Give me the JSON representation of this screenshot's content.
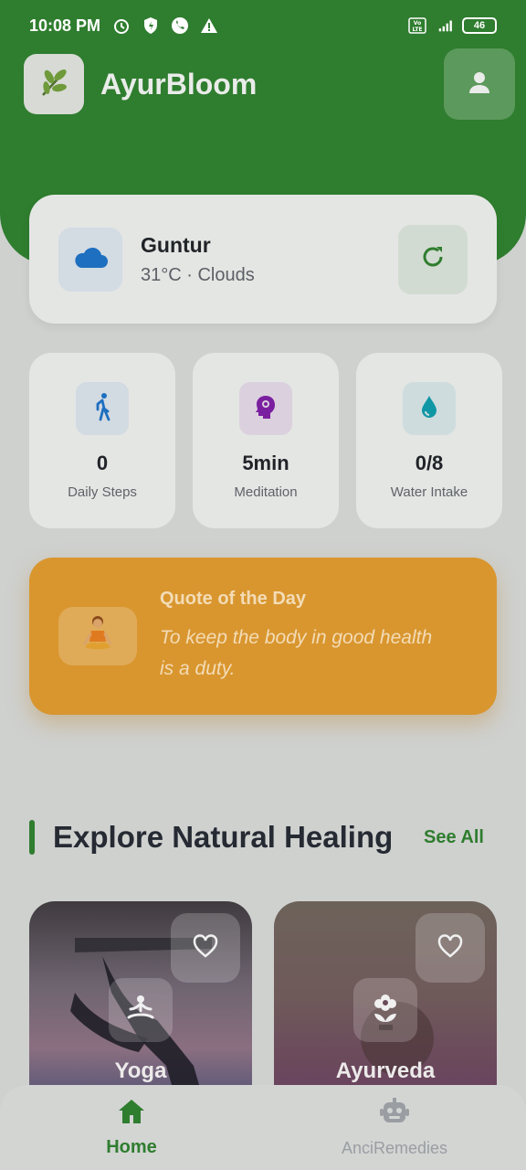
{
  "status_bar": {
    "time": "10:08 PM",
    "left_icons": [
      "alarm-icon",
      "shield-icon",
      "phone-wifi-icon",
      "warning-icon"
    ],
    "right_icons": [
      "volte-icon",
      "signal-4g-icon"
    ],
    "battery": "46"
  },
  "header": {
    "app_name": "AyurBloom",
    "logo_icon": "leaf-icon",
    "profile_icon": "person-icon",
    "background_color": "#2f7d2f"
  },
  "weather": {
    "city": "Guntur",
    "description": "31°C · Clouds",
    "icon": "cloud-icon",
    "refresh_icon": "refresh-icon"
  },
  "stats": [
    {
      "value": "0",
      "label": "Daily Steps",
      "icon": "walking-icon",
      "color": "#1e6fbf"
    },
    {
      "value": "5min",
      "label": "Meditation",
      "icon": "brain-icon",
      "color": "#7a1fa0"
    },
    {
      "value": "0/8",
      "label": "Water Intake",
      "icon": "water-drop-icon",
      "color": "#0f97a5"
    }
  ],
  "quote": {
    "title": "Quote of the Day",
    "text": "To keep the body in good health is a duty.",
    "icon": "meditating-person-icon",
    "color": "#d9962f"
  },
  "explore": {
    "title": "Explore Natural Healing",
    "see_all": "See All",
    "cards": [
      {
        "label": "Yoga",
        "icon": "yoga-pose-icon",
        "fav_icon": "heart-outline-icon"
      },
      {
        "label": "Ayurveda",
        "icon": "flower-icon",
        "fav_icon": "heart-outline-icon"
      }
    ]
  },
  "bottom_nav": {
    "items": [
      {
        "label": "Home",
        "icon": "home-icon",
        "active": true
      },
      {
        "label": "AnciRemedies",
        "icon": "robot-icon",
        "active": false
      }
    ],
    "accent": "#2f7d2f"
  }
}
